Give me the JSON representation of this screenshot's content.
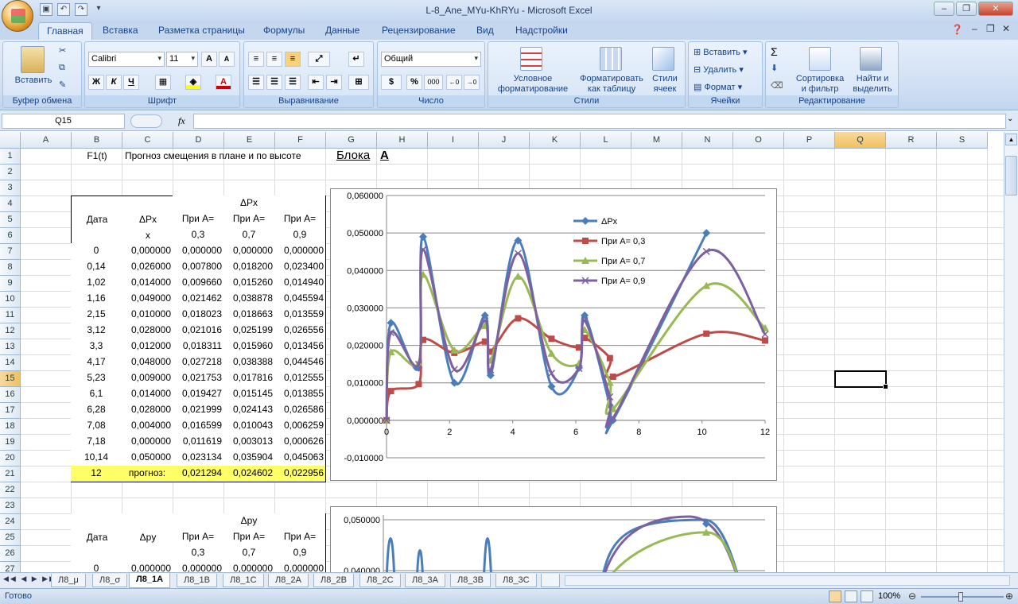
{
  "window": {
    "title": "L-8_Ane_MYu-KhRYu - Microsoft Excel"
  },
  "ribbon": {
    "tabs": [
      "Главная",
      "Вставка",
      "Разметка страницы",
      "Формулы",
      "Данные",
      "Рецензирование",
      "Вид",
      "Надстройки"
    ],
    "groups": {
      "clipboard": {
        "label": "Буфер обмена",
        "paste": "Вставить"
      },
      "font": {
        "label": "Шрифт",
        "font_name": "Calibri",
        "font_size": "11",
        "bold": "Ж",
        "italic": "К",
        "underline": "Ч"
      },
      "alignment": {
        "label": "Выравнивание"
      },
      "number": {
        "label": "Число",
        "format": "Общий",
        "currency": "$",
        "percent": "%",
        "thousands": "000"
      },
      "styles": {
        "label": "Стили",
        "conditional_1": "Условное",
        "conditional_2": "форматирование",
        "table_1": "Форматировать",
        "table_2": "как таблицу",
        "cell_1": "Стили",
        "cell_2": "ячеек"
      },
      "cells": {
        "label": "Ячейки",
        "insert": "Вставить",
        "delete": "Удалить",
        "format": "Формат"
      },
      "editing": {
        "label": "Редактирование",
        "sort_1": "Сортировка",
        "sort_2": "и фильтр",
        "find_1": "Найти и",
        "find_2": "выделить",
        "sum": "Σ"
      }
    }
  },
  "formula_bar": {
    "name_box": "Q15",
    "fx": "fx",
    "value": ""
  },
  "columns": [
    "A",
    "B",
    "C",
    "D",
    "E",
    "F",
    "G",
    "H",
    "I",
    "J",
    "K",
    "L",
    "M",
    "N",
    "O",
    "P",
    "Q",
    "R",
    "S"
  ],
  "rows": [
    "1",
    "2",
    "3",
    "4",
    "5",
    "6",
    "7",
    "8",
    "9",
    "10",
    "11",
    "12",
    "13",
    "14",
    "15",
    "16",
    "17",
    "18",
    "19",
    "20",
    "21",
    "22",
    "23",
    "24",
    "25",
    "26",
    "27"
  ],
  "sheet": {
    "b1": "F1(t)",
    "c1": "Прогноз смещения в плане и по высоте",
    "g1": "Блока",
    "h1": "А",
    "table1": {
      "header_group": "ΔPx",
      "col_date": "Дата",
      "col_dpx": "ΔPx",
      "col_dpx_sub": "x",
      "col_a": [
        "При А=",
        "При А=",
        "При А="
      ],
      "col_a_vals": [
        "0,3",
        "0,7",
        "0,9"
      ],
      "rows": [
        [
          "0",
          "0,000000",
          "0,000000",
          "0,000000",
          "0,000000"
        ],
        [
          "0,14",
          "0,026000",
          "0,007800",
          "0,018200",
          "0,023400"
        ],
        [
          "1,02",
          "0,014000",
          "0,009660",
          "0,015260",
          "0,014940"
        ],
        [
          "1,16",
          "0,049000",
          "0,021462",
          "0,038878",
          "0,045594"
        ],
        [
          "2,15",
          "0,010000",
          "0,018023",
          "0,018663",
          "0,013559"
        ],
        [
          "3,12",
          "0,028000",
          "0,021016",
          "0,025199",
          "0,026556"
        ],
        [
          "3,3",
          "0,012000",
          "0,018311",
          "0,015960",
          "0,013456"
        ],
        [
          "4,17",
          "0,048000",
          "0,027218",
          "0,038388",
          "0,044546"
        ],
        [
          "5,23",
          "0,009000",
          "0,021753",
          "0,017816",
          "0,012555"
        ],
        [
          "6,1",
          "0,014000",
          "0,019427",
          "0,015145",
          "0,013855"
        ],
        [
          "6,28",
          "0,028000",
          "0,021999",
          "0,024143",
          "0,026586"
        ],
        [
          "7,08",
          "0,004000",
          "0,016599",
          "0,010043",
          "0,006259"
        ],
        [
          "7,18",
          "0,000000",
          "0,011619",
          "0,003013",
          "0,000626"
        ],
        [
          "10,14",
          "0,050000",
          "0,023134",
          "0,035904",
          "0,045063"
        ]
      ],
      "forecast": [
        "12",
        "прогноз:",
        "0,021294",
        "0,024602",
        "0,022956"
      ]
    },
    "table2": {
      "header_group": "Δpy",
      "col_date": "Дата",
      "col_dpy": "Δpy",
      "col_a": [
        "При А=",
        "При А=",
        "При А="
      ],
      "col_a_vals": [
        "0,3",
        "0,7",
        "0,9"
      ],
      "partial_row": [
        "0",
        "0,000000",
        "0,000000",
        "0,000000",
        "0,000000"
      ]
    }
  },
  "chart_data": [
    {
      "type": "line",
      "title": "",
      "xlim": [
        0,
        12
      ],
      "ylim": [
        -0.01,
        0.06
      ],
      "x_ticks": [
        "0",
        "2",
        "4",
        "6",
        "8",
        "10",
        "12"
      ],
      "y_ticks": [
        "-0,010000",
        "0,000000",
        "0,010000",
        "0,020000",
        "0,030000",
        "0,040000",
        "0,050000",
        "0,060000"
      ],
      "grid": "horizontal",
      "legend": "top-right",
      "x": [
        0,
        0.14,
        1.02,
        1.16,
        2.15,
        3.12,
        3.3,
        4.17,
        5.23,
        6.1,
        6.28,
        7.08,
        7.18,
        10.14,
        12
      ],
      "series": [
        {
          "name": "ΔPx",
          "color": "#4a7ebb",
          "marker": "diamond",
          "values": [
            0,
            0.026,
            0.014,
            0.049,
            0.01,
            0.028,
            0.012,
            0.048,
            0.009,
            0.014,
            0.028,
            0.004,
            0.0,
            0.05,
            null
          ]
        },
        {
          "name": "При А= 0,3",
          "color": "#be4b48",
          "marker": "square",
          "values": [
            0,
            0.0078,
            0.00966,
            0.021462,
            0.018023,
            0.021016,
            0.018311,
            0.027218,
            0.021753,
            0.019427,
            0.021999,
            0.016599,
            0.011619,
            0.023134,
            0.021294
          ]
        },
        {
          "name": "При А= 0,7",
          "color": "#98b954",
          "marker": "triangle",
          "values": [
            0,
            0.0182,
            0.01526,
            0.038878,
            0.018663,
            0.025199,
            0.01596,
            0.038388,
            0.017816,
            0.015145,
            0.024143,
            0.010043,
            0.003013,
            0.035904,
            0.024602
          ]
        },
        {
          "name": "При А= 0,9",
          "color": "#7d60a0",
          "marker": "x",
          "values": [
            0,
            0.0234,
            0.01494,
            0.045594,
            0.013559,
            0.026556,
            0.013456,
            0.044546,
            0.012555,
            0.013855,
            0.026586,
            0.006259,
            0.000626,
            0.045063,
            0.022956
          ]
        }
      ]
    },
    {
      "type": "line",
      "title": "",
      "y_ticks": [
        "0,050000",
        "0,040000"
      ],
      "grid": "horizontal"
    }
  ],
  "sheet_tabs": [
    "Л8_μ",
    "Л8_σ",
    "Л8_1А",
    "Л8_1В",
    "Л8_1С",
    "Л8_2А",
    "Л8_2В",
    "Л8_2С",
    "Л8_3А",
    "Л8_3В",
    "Л8_3С"
  ],
  "active_tab": "Л8_1А",
  "status": {
    "ready": "Готово",
    "zoom": "100%"
  }
}
